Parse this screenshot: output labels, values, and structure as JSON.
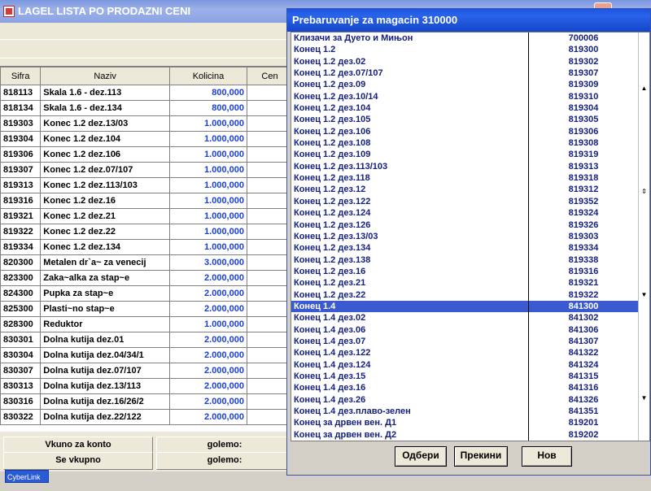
{
  "background_window": {
    "title": "LAGEL LISTA PO PRODAZNI CENI",
    "columns": [
      "Sifra",
      "Naziv",
      "Kolicina",
      "Cen"
    ],
    "rows": [
      {
        "sifra": "818113",
        "naziv": "Skala 1.6 - dez.113",
        "kolicina": "800,000"
      },
      {
        "sifra": "818134",
        "naziv": "Skala 1.6 - dez.134",
        "kolicina": "800,000"
      },
      {
        "sifra": "819303",
        "naziv": "Konec 1.2 dez.13/03",
        "kolicina": "1.000,000"
      },
      {
        "sifra": "819304",
        "naziv": "Konec 1.2 dez.104",
        "kolicina": "1.000,000"
      },
      {
        "sifra": "819306",
        "naziv": "Konec 1.2 dez.106",
        "kolicina": "1.000,000"
      },
      {
        "sifra": "819307",
        "naziv": "Konec 1.2 dez.07/107",
        "kolicina": "1.000,000"
      },
      {
        "sifra": "819313",
        "naziv": "Konec 1.2 dez.113/103",
        "kolicina": "1.000,000"
      },
      {
        "sifra": "819316",
        "naziv": "Konec 1.2 dez.16",
        "kolicina": "1.000,000"
      },
      {
        "sifra": "819321",
        "naziv": "Konec 1.2 dez.21",
        "kolicina": "1.000,000"
      },
      {
        "sifra": "819322",
        "naziv": "Konec 1.2 dez.22",
        "kolicina": "1.000,000"
      },
      {
        "sifra": "819334",
        "naziv": "Konec 1.2 dez.134",
        "kolicina": "1.000,000"
      },
      {
        "sifra": "820300",
        "naziv": "Metalen dr`a~ za venecij",
        "kolicina": "3.000,000"
      },
      {
        "sifra": "823300",
        "naziv": "Zaka~alka za stap~e",
        "kolicina": "2.000,000"
      },
      {
        "sifra": "824300",
        "naziv": "Pupka za stap~e",
        "kolicina": "2.000,000"
      },
      {
        "sifra": "825300",
        "naziv": "Plasti~no stap~e",
        "kolicina": "2.000,000"
      },
      {
        "sifra": "828300",
        "naziv": "Reduktor",
        "kolicina": "1.000,000"
      },
      {
        "sifra": "830301",
        "naziv": "Dolna kutija dez.01",
        "kolicina": "2.000,000"
      },
      {
        "sifra": "830304",
        "naziv": "Dolna kutija dez.04/34/1",
        "kolicina": "2.000,000"
      },
      {
        "sifra": "830307",
        "naziv": "Dolna kutija dez.07/107",
        "kolicina": "2.000,000"
      },
      {
        "sifra": "830313",
        "naziv": "Dolna kutija dez.13/113",
        "kolicina": "2.000,000"
      },
      {
        "sifra": "830316",
        "naziv": "Dolna kutija dez.16/26/2",
        "kolicina": "2.000,000"
      },
      {
        "sifra": "830322",
        "naziv": "Dolna kutija dez.22/122",
        "kolicina": "2.000,000"
      }
    ],
    "footer": {
      "vkupno_za_konto": "Vkuno za konto",
      "se_vkupno": "Se vkupno",
      "golemo1": "golemo:",
      "golemo2": "golemo:"
    },
    "taskbar_item": "CyberLink"
  },
  "dialog": {
    "title": "Prebaruvanje za magacin 310000",
    "items": [
      {
        "name": "Клизачи за Дуето и Мињон",
        "code": "700006"
      },
      {
        "name": "Конец 1.2",
        "code": "819300"
      },
      {
        "name": "Конец 1.2 дез.02",
        "code": "819302"
      },
      {
        "name": "Конец 1.2 дез.07/107",
        "code": "819307"
      },
      {
        "name": "Конец 1.2 дез.09",
        "code": "819309"
      },
      {
        "name": "Конец 1.2 дез.10/14",
        "code": "819310"
      },
      {
        "name": "Конец 1.2 дез.104",
        "code": "819304"
      },
      {
        "name": "Конец 1.2 дез.105",
        "code": "819305"
      },
      {
        "name": "Конец 1.2 дез.106",
        "code": "819306"
      },
      {
        "name": "Конец 1.2 дез.108",
        "code": "819308"
      },
      {
        "name": "Конец 1.2 дез.109",
        "code": "819319"
      },
      {
        "name": "Конец 1.2 дез.113/103",
        "code": "819313"
      },
      {
        "name": "Конец 1.2 дез.118",
        "code": "819318"
      },
      {
        "name": "Конец 1.2 дез.12",
        "code": "819312"
      },
      {
        "name": "Конец 1.2 дез.122",
        "code": "819352"
      },
      {
        "name": "Конец 1.2 дез.124",
        "code": "819324"
      },
      {
        "name": "Конец 1.2 дез.126",
        "code": "819326"
      },
      {
        "name": "Конец 1.2 дез.13/03",
        "code": "819303"
      },
      {
        "name": "Конец 1.2 дез.134",
        "code": "819334"
      },
      {
        "name": "Конец 1.2 дез.138",
        "code": "819338"
      },
      {
        "name": "Конец 1.2 дез.16",
        "code": "819316"
      },
      {
        "name": "Конец 1.2 дез.21",
        "code": "819321"
      },
      {
        "name": "Конец 1.2 дез.22",
        "code": "819322"
      },
      {
        "name": "Конец 1.4",
        "code": "841300"
      },
      {
        "name": "Конец 1.4 дез.02",
        "code": "841302"
      },
      {
        "name": "Конец 1.4 дез.06",
        "code": "841306"
      },
      {
        "name": "Конец 1.4 дез.07",
        "code": "841307"
      },
      {
        "name": "Конец 1.4 дез.122",
        "code": "841322"
      },
      {
        "name": "Конец 1.4 дез.124",
        "code": "841324"
      },
      {
        "name": "Конец 1.4 дез.15",
        "code": "841315"
      },
      {
        "name": "Конец 1.4 дез.16",
        "code": "841316"
      },
      {
        "name": "Конец 1.4 дез.26",
        "code": "841326"
      },
      {
        "name": "Конец 1.4 дез.плаво-зелен",
        "code": "841351"
      },
      {
        "name": "Конец за дрвен вен. Д1",
        "code": "819201"
      },
      {
        "name": "Конец за дрвен вен. Д2",
        "code": "819202"
      }
    ],
    "selected_index": 23,
    "buttons": {
      "select": "Одбери",
      "cancel": "Прекини",
      "new": "Нов"
    }
  },
  "colors": {
    "selection": "#3a5ad0",
    "list_text": "#14217f",
    "dialog_title": "#1b54e0",
    "quantity_text": "#1a3fd8"
  }
}
